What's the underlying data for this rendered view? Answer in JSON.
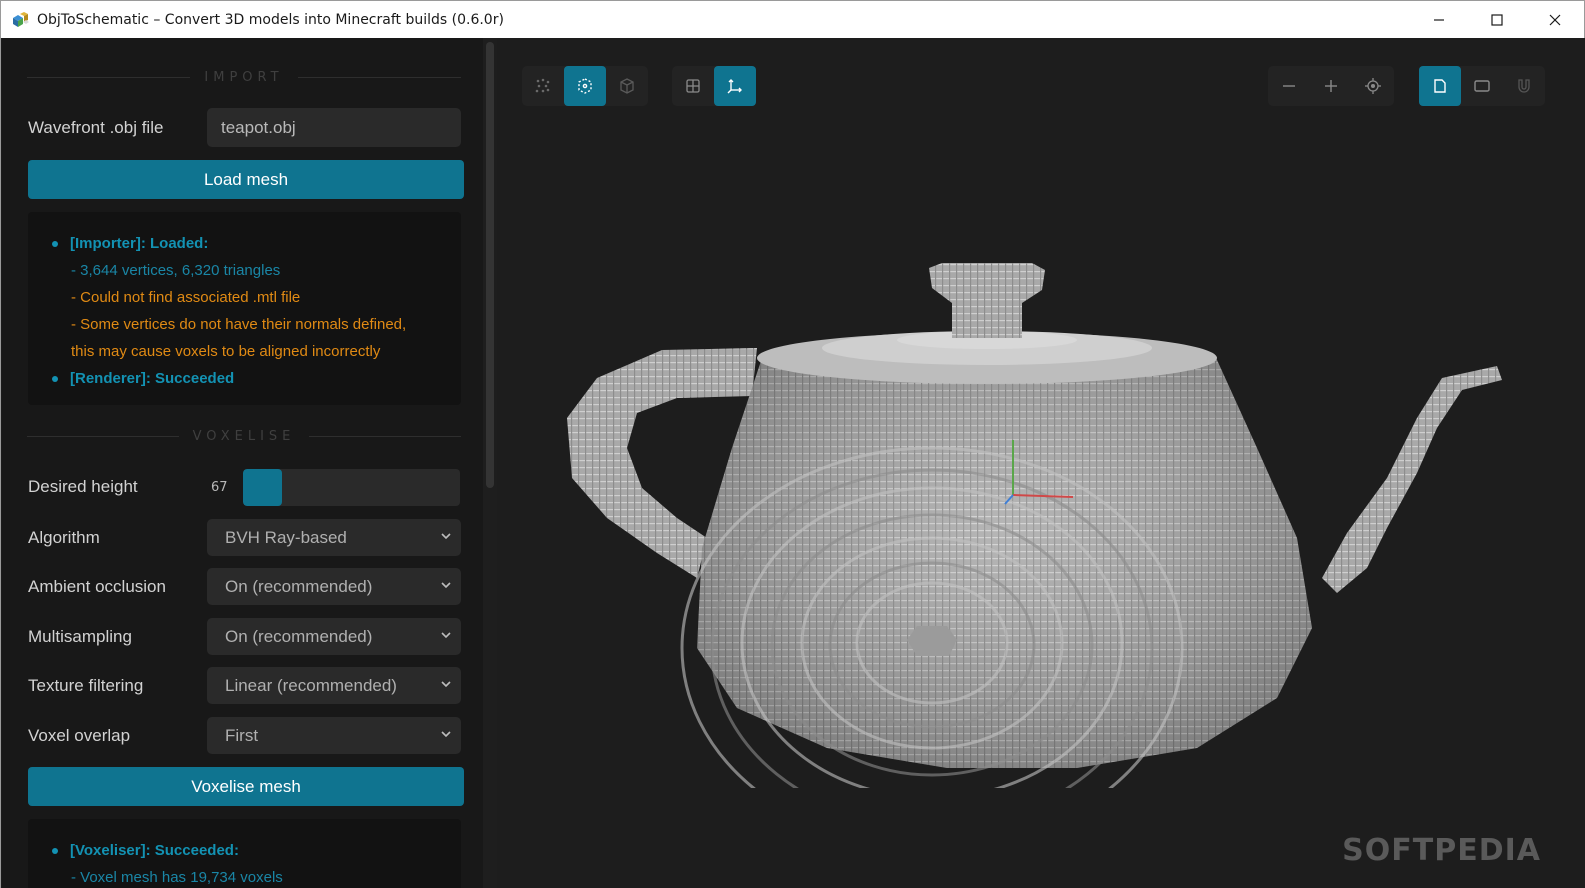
{
  "window": {
    "title": "ObjToSchematic – Convert 3D models into Minecraft builds (0.6.0r)",
    "controls": {
      "minimize": "–",
      "maximize": "☐",
      "close": "✕"
    }
  },
  "sidebar": {
    "import": {
      "heading": "IMPORT",
      "file_label": "Wavefront .obj file",
      "file_value": "teapot.obj",
      "load_button": "Load mesh",
      "log": {
        "importer_head": "[Importer]: Loaded:",
        "importer_info": "- 3,644 vertices, 6,320 triangles",
        "importer_warn1": "- Could not find associated .mtl file",
        "importer_warn2a": "- Some vertices do not have their normals defined,",
        "importer_warn2b": "this may cause voxels to be aligned incorrectly",
        "renderer_head": "[Renderer]: Succeeded"
      }
    },
    "voxelise": {
      "heading": "VOXELISE",
      "desired_height_label": "Desired height",
      "desired_height_value": "67",
      "desired_height_fraction": 0.18,
      "algorithm_label": "Algorithm",
      "algorithm_value": "BVH Ray-based",
      "ambient_label": "Ambient occlusion",
      "ambient_value": "On (recommended)",
      "multisampling_label": "Multisampling",
      "multisampling_value": "On (recommended)",
      "texture_label": "Texture filtering",
      "texture_value": "Linear (recommended)",
      "overlap_label": "Voxel overlap",
      "overlap_value": "First",
      "voxelise_button": "Voxelise mesh",
      "log": {
        "voxeliser_head": "[Voxeliser]: Succeeded:",
        "voxeliser_info": "- Voxel mesh has 19,734 voxels"
      }
    }
  },
  "viewport": {
    "accent": "#0f7490",
    "watermark": "SOFTPEDIA"
  }
}
